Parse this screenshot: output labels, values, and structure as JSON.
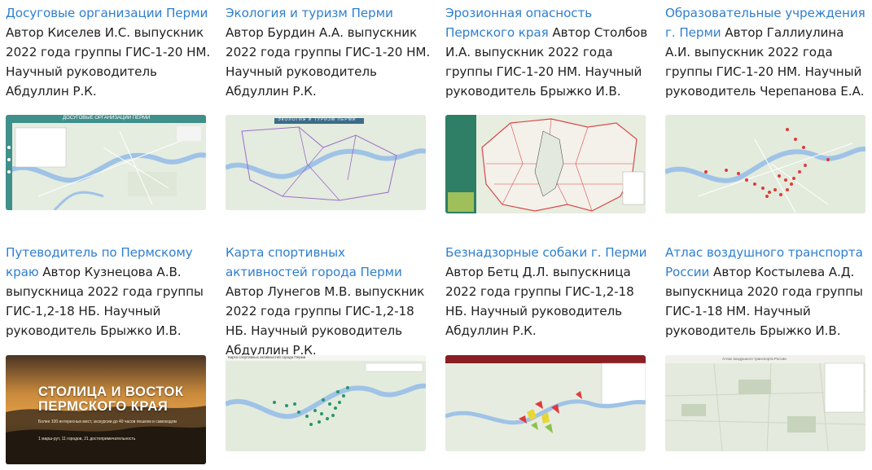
{
  "cards": [
    {
      "title": "Досуговые организации Перми",
      "desc": " Автор Киселев И.С. выпускник 2022 года группы ГИС-1-20 НМ. Научный руководитель Абдуллин Р.К.",
      "thumb": "досуговые-организации-map"
    },
    {
      "title": " Экология и туризм Перми",
      "desc": " Автор Бурдин А.А. выпускник 2022 года группы ГИС-1-20 НМ. Научный руководитель Абдуллин Р.К.",
      "thumb": "экология-и-туризм-map"
    },
    {
      "title": "Эрозионная опасность Пермского края",
      "desc": " Автор Столбов И.А. выпускник 2022 года группы ГИС-1-20 НМ. Научный руководитель Брыжко И.В.",
      "thumb": "эрозионная-опасность-map"
    },
    {
      "title": "Образовательные учреждения г. Перми",
      "desc": " Автор Галлиулина А.И. выпускник 2022 года группы ГИС-1-20 НМ. Научный руководитель Черепанова Е.А.",
      "thumb": "образовательные-учреждения-map"
    },
    {
      "title": "Путеводитель по Пермскому краю",
      "desc": " Автор Кузнецова А.В. выпускница 2022 года группы ГИС-1,2-18 НБ. Научный руководитель Брыжко И.В.",
      "thumb": "путеводитель-hero"
    },
    {
      "title": "Карта спортивных активностей города Перми",
      "desc": " Автор Лунегов М.В. выпускник 2022 года группы ГИС-1,2-18 НБ. Научный руководитель Абдуллин Р.К.",
      "thumb": "спортивные-активности-map"
    },
    {
      "title": "Безнадзорные собаки г. Перми",
      "desc": " Автор Бетц Д.Л. выпускница 2022 года группы ГИС-1,2-18 НБ. Научный руководитель Абдуллин Р.К.",
      "thumb": "безнадзорные-собаки-map"
    },
    {
      "title": "Атлас воздушного транспорта России",
      "desc": " Автор Костылева А.Д. выпускница 2020 года группы ГИС-1-18 НМ. Научный руководитель Брыжко И.В.",
      "thumb": "атлас-воздушного-транспорта-map"
    }
  ],
  "thumb_text": {
    "t1_header": "ДОСУГОВЫЕ ОРГАНИЗАЦИИ ПЕРМИ",
    "t2_header": "ЭКОЛОГИЯ И ТУРИЗМ ПЕРМИ",
    "t5_title_line1": "СТОЛИЦА И ВОСТОК",
    "t5_title_line2": "ПЕРМСКОГО КРАЯ",
    "t5_subtitle": "Более 100 интересных мест, экскурсии до 40 часов пешком и самоходом",
    "t5_meta": "1 марш-рут, 11 городов, 21 достопримечательность",
    "t6_header": "Карта спортивных активностей города Перми",
    "t8_header": "Атлас воздушного транспорта России"
  },
  "colors": {
    "link": "#2f7fd0",
    "text": "#222222"
  }
}
